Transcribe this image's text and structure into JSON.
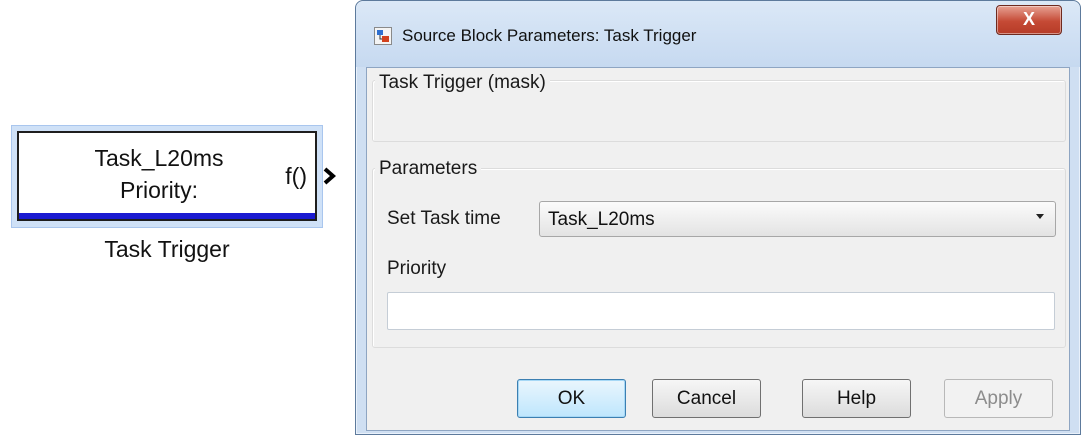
{
  "block": {
    "line1": "Task_L20ms",
    "line2": "Priority:",
    "port_label": "f()",
    "name": "Task Trigger"
  },
  "dialog": {
    "title": "Source Block Parameters: Task Trigger",
    "close_glyph": "X",
    "mask_group_title": "Task Trigger (mask)",
    "params_group_title": "Parameters",
    "task_time_label": "Set Task time",
    "task_time_value": "Task_L20ms",
    "priority_label": "Priority",
    "priority_value": "",
    "buttons": {
      "ok": "OK",
      "cancel": "Cancel",
      "help": "Help",
      "apply": "Apply"
    }
  },
  "colors": {
    "block_bottom_bar": "#1a1ad0",
    "selection_halo": "#cfe1f7",
    "close_button": "#c54a35",
    "default_button": "#bee6fd"
  }
}
